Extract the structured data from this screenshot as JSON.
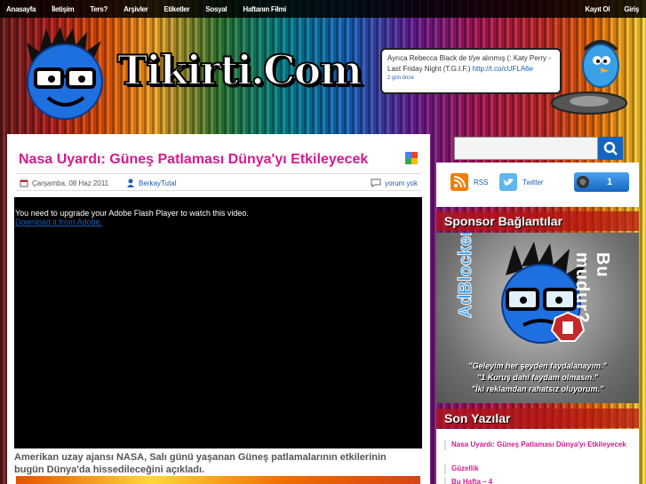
{
  "topbar": {
    "nav": [
      "Anasayfa",
      "İletişim",
      "Ters?",
      "Arşivler",
      "Etiketler",
      "Sosyal",
      "Haftanın Filmi"
    ],
    "right": [
      "Kayıt Ol",
      "Giriş"
    ]
  },
  "site": {
    "logo_text": "Tikirti.Com"
  },
  "tweet": {
    "text": "Ayrıca Rebecca Black de t/ye alınmış (: Katy Perry - Last Friday Night (T.G.I.F.)",
    "link": "http://t.co/cUFLA6e",
    "time": "2 gün önce"
  },
  "post": {
    "title": "Nasa Uyardı: Güneş Patlaması Dünya'yı Etkileyecek",
    "date": "Çarşamba, 08 Haz 2011",
    "author": "BerkayTutal",
    "comments": "yorum yok",
    "video_message": "You need to upgrade your Adobe Flash Player to watch this video.",
    "video_link": "Download it from Adobe.",
    "summary": "Amerikan uzay ajansı NASA, Salı günü yaşanan Güneş patlamalarının etkilerinin bugün Dünya'da hissedileceğini açıkladı."
  },
  "sidebar": {
    "search_placeholder": "",
    "rss": "RSS",
    "twitter": "Twitter",
    "counter": "1",
    "sponsor_title": "Sponsor Bağlantılar",
    "ad": {
      "left_word": "AdBlocker?",
      "right_word": "Bu mudur?",
      "quote1": "\"Geleyim her şeyden faydalanayım.\"",
      "quote2": "\"1 Kuruş dahi faydam olmasın.\"",
      "quote3": "\"İki reklamdan rahatsız oluyorum.\""
    },
    "recent_title": "Son Yazılar",
    "recent": [
      "Nasa Uyardı: Güneş Patlaması Dünya'yı Etkileyecek",
      "Güzellik",
      "Bu Hafta – 4"
    ]
  },
  "colors": {
    "accent": "#d6198f",
    "link": "#1a5fb4",
    "head": "#b41414"
  }
}
